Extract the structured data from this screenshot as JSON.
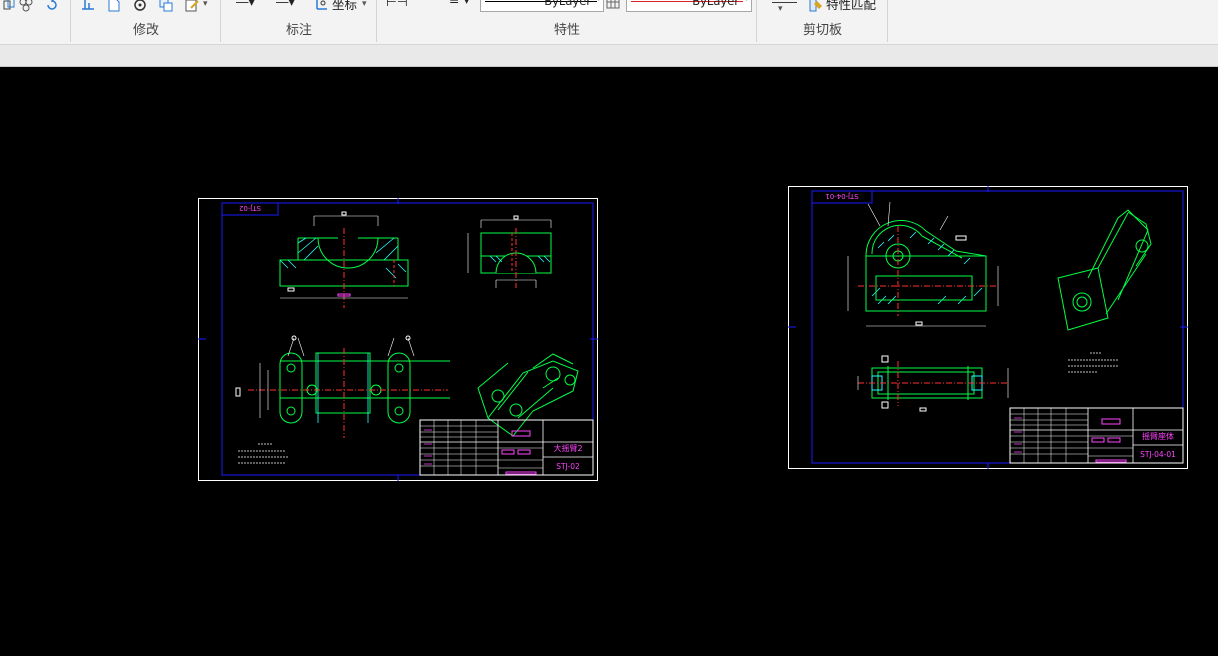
{
  "ribbon": {
    "panels": {
      "modify": "修改",
      "annotation": "标注",
      "properties": "特性",
      "clipboard": "剪切板"
    },
    "coordinate_label": "坐标",
    "linetype_value": "ByLayer",
    "color_value": "ByLayer",
    "clipboard_action": "特性匹配"
  },
  "drawings": [
    {
      "id": "left",
      "tag": "STJ-02",
      "title_name": "大摇臂2",
      "drawing_no": "STJ-02"
    },
    {
      "id": "right",
      "tag": "STJ-04-01",
      "title_name": "摇臂座体",
      "drawing_no": "STJ-04-01"
    }
  ],
  "colors": {
    "background": "#000000",
    "frame": "#ffffff",
    "border": "#1a1aff",
    "geometry": "#00ff44",
    "section": "#22ffff",
    "center": "#ff3030",
    "text": "#ff44ff",
    "dims": "#ffffff"
  }
}
